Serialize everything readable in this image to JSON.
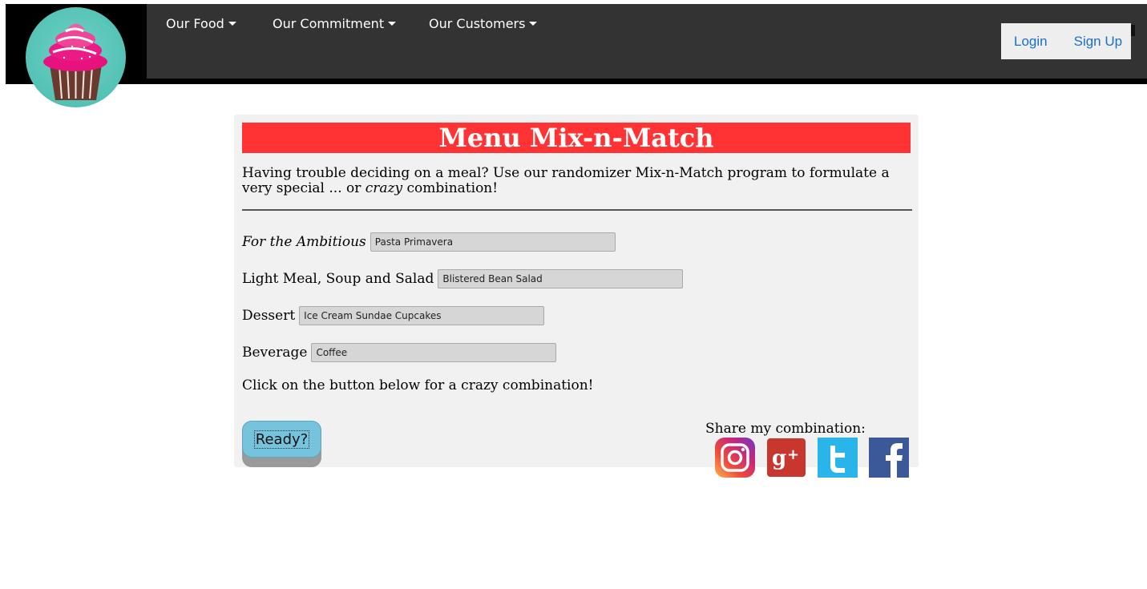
{
  "nav": {
    "items": [
      {
        "label": "Our Food"
      },
      {
        "label": "Our Commitment"
      },
      {
        "label": "Our Customers"
      }
    ],
    "login": "Login",
    "signup": "Sign Up"
  },
  "main": {
    "title": "Menu Mix-n-Match",
    "intro_before": "Having trouble deciding on a meal? Use our randomizer Mix-n-Match program to formulate a very special ... or ",
    "intro_em": "crazy",
    "intro_after": " combination!",
    "fields": [
      {
        "label": "For the Ambitious",
        "value": "Pasta Primavera"
      },
      {
        "label": "Light Meal, Soup and Salad",
        "value": "Blistered Bean Salad"
      },
      {
        "label": "Dessert",
        "value": "Ice Cream Sundae Cupcakes"
      },
      {
        "label": "Beverage",
        "value": "Coffee"
      }
    ],
    "hint": "Click on the button below for a crazy combination!",
    "button": "Ready?",
    "share_label": "Share my combination:"
  },
  "icons": {
    "logo": "cupcake-logo-icon",
    "social": [
      "instagram-icon",
      "google-plus-icon",
      "twitter-icon",
      "facebook-icon"
    ]
  },
  "colors": {
    "header": "#333333",
    "title_bar": "#ff3333",
    "button": "#75c3dc",
    "link": "#1a6fc9"
  }
}
